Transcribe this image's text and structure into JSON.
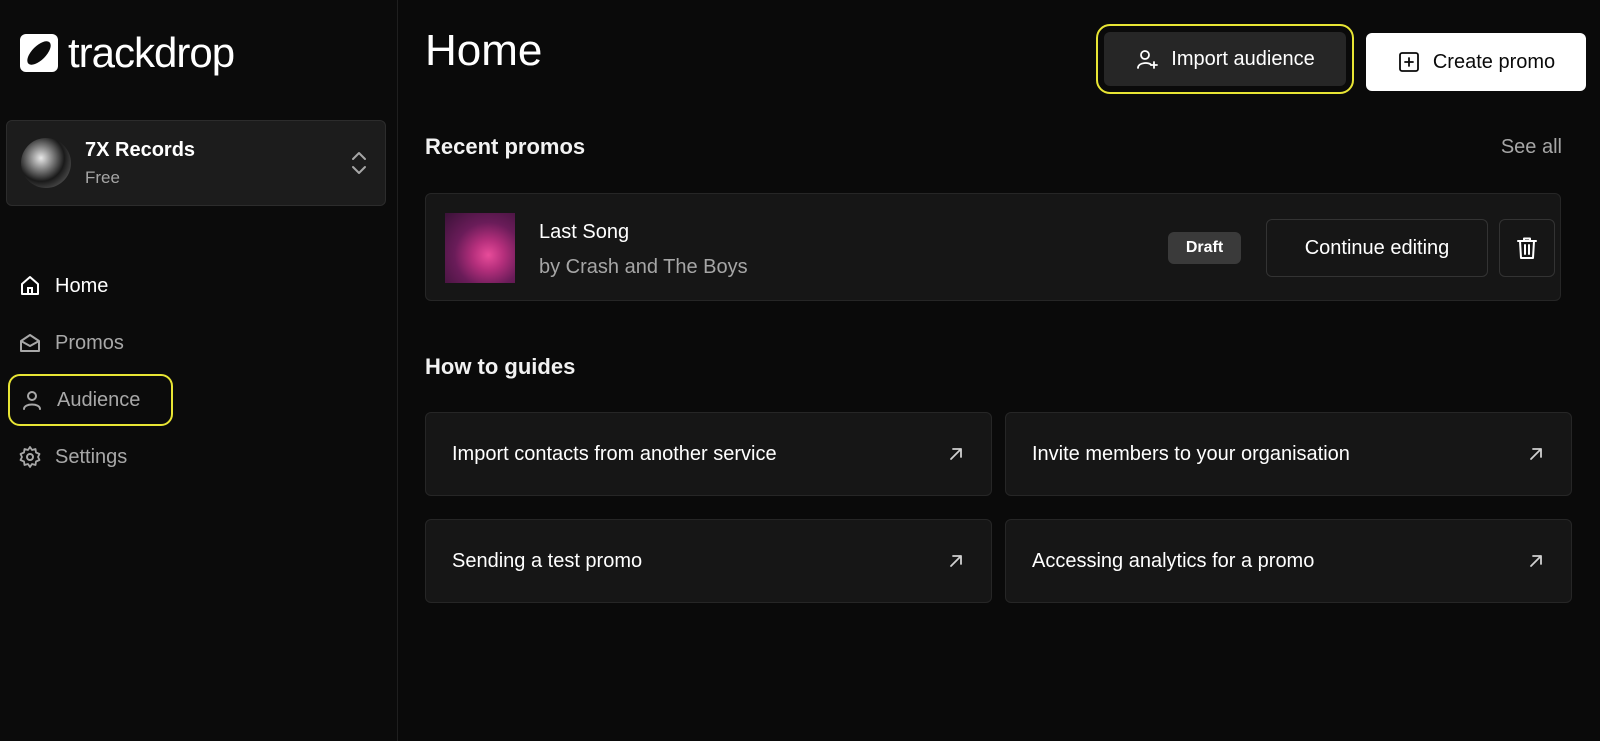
{
  "app": {
    "logo_text": "trackdrop"
  },
  "org": {
    "name": "7X Records",
    "plan": "Free"
  },
  "sidebar": {
    "items": [
      {
        "label": "Home",
        "icon": "home-icon"
      },
      {
        "label": "Promos",
        "icon": "mail-open-icon"
      },
      {
        "label": "Audience",
        "icon": "user-icon"
      },
      {
        "label": "Settings",
        "icon": "gear-icon"
      }
    ]
  },
  "header": {
    "title": "Home",
    "import_label": "Import audience",
    "create_label": "Create promo"
  },
  "recent": {
    "title": "Recent promos",
    "see_all": "See all",
    "promos": [
      {
        "title": "Last Song",
        "artist": "by Crash and The Boys",
        "status": "Draft",
        "action": "Continue editing"
      }
    ]
  },
  "guides": {
    "title": "How to guides",
    "items": [
      {
        "label": "Import contacts from another service"
      },
      {
        "label": "Invite members to your organisation"
      },
      {
        "label": "Sending a test promo"
      },
      {
        "label": "Accessing analytics for a promo"
      }
    ]
  },
  "colors": {
    "background": "#0a0a0a",
    "card": "#161616",
    "highlight": "#e8e534",
    "muted_text": "#a6a6a6"
  }
}
